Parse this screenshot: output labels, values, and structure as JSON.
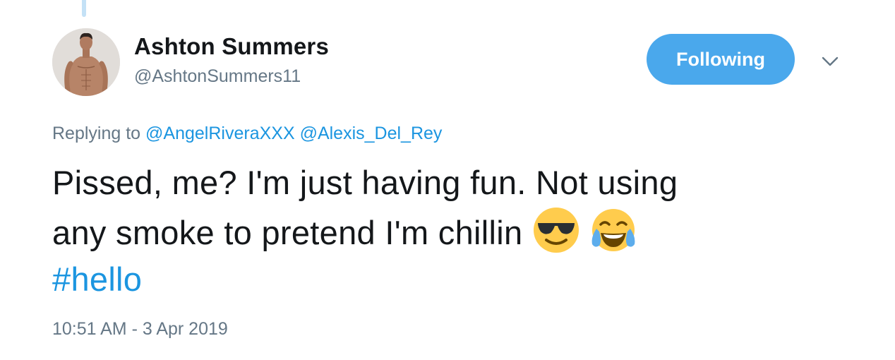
{
  "tweet": {
    "author": {
      "display_name": "Ashton Summers",
      "handle": "@AshtonSummers11",
      "avatar": "profile-photo"
    },
    "follow_button": {
      "label": "Following",
      "color": "#4aa8ec"
    },
    "menu_icon": "chevron-down-icon",
    "reply": {
      "prefix": "Replying to",
      "mentions": [
        "@AngelRiveraXXX",
        "@Alexis_Del_Rey"
      ]
    },
    "body": {
      "line1": "Pissed, me? I'm just having fun. Not using",
      "line2": "any smoke to pretend I'm chillin",
      "emojis": [
        "smiling-face-with-sunglasses",
        "face-with-tears-of-joy"
      ],
      "hashtag": "#hello"
    },
    "timestamp": "10:51 AM - 3 Apr 2019"
  },
  "colors": {
    "text": "#14171a",
    "secondary": "#657786",
    "link": "#1b95e0",
    "thread_line": "#c4e1f6"
  }
}
